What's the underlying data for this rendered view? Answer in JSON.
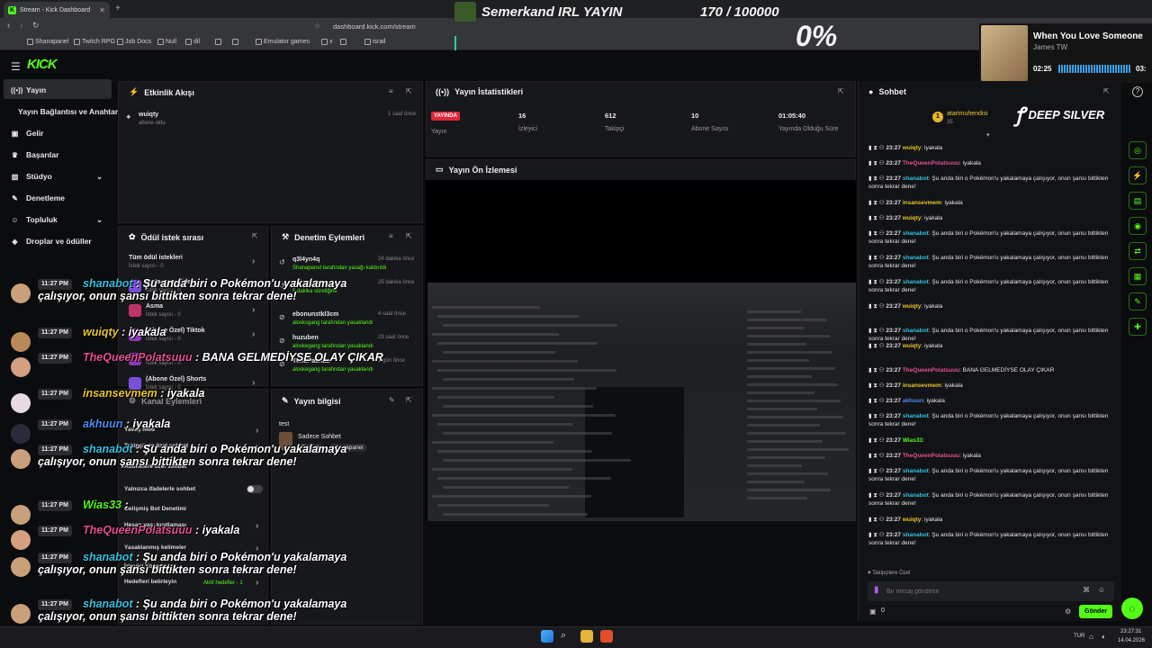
{
  "browser": {
    "tab_title": "Stream - Kick Dashboard",
    "url": "dashboard.kick.com/stream",
    "bookmarks": [
      "Shanapanel",
      "Twitch RPG",
      "Job Docs",
      "Null",
      "dil",
      "",
      "",
      "Emulator games",
      "x",
      "",
      "israil"
    ]
  },
  "overlay": {
    "title": "Semerkand IRL YAYIN",
    "goal": "170 / 100000",
    "percent": "0%",
    "deep_silver": "DEEP SILVER"
  },
  "music": {
    "song": "When You Love Someone",
    "artist": "James TW",
    "elapsed": "02:25",
    "total": "03:"
  },
  "app": {
    "logo": "KICK"
  },
  "sidebar": {
    "items": [
      {
        "label": "Yayın",
        "icon": "live-icon"
      },
      {
        "label": "Yayın Bağlantısı ve Anahtarı",
        "icon": ""
      },
      {
        "label": "Gelir",
        "icon": "dollar-icon"
      },
      {
        "label": "Başarılar",
        "icon": "trophy-icon"
      },
      {
        "label": "Stüdyo",
        "icon": "studio-icon"
      },
      {
        "label": "Denetleme",
        "icon": "wrench-icon"
      },
      {
        "label": "Topluluk",
        "icon": "community-icon"
      },
      {
        "label": "Droplar ve ödüller",
        "icon": "drops-icon"
      }
    ]
  },
  "activity": {
    "title": "Etkinlik Akışı",
    "items": [
      {
        "user": "wuiqty",
        "action": "abone oldu",
        "time": "1 saat önce"
      }
    ]
  },
  "stats": {
    "title": "Yayın İstatistikleri",
    "live_badge": "YAYINDA",
    "live_label": "Yayın",
    "viewers": "16",
    "viewers_label": "İzleyici",
    "followers": "612",
    "followers_label": "Takipçi",
    "subs": "10",
    "subs_label": "Abone Sayısı",
    "uptime": "01:05:40",
    "uptime_label": "Yayında Olduğu Süre"
  },
  "preview": {
    "title": "Yayın Ön İzlemesi"
  },
  "rewards": {
    "title": "Ödül istek sırası",
    "items": [
      {
        "label": "Tüm ödül istekleri",
        "sub": "İstek sayısı - 0"
      },
      {
        "label": "Instagram Video",
        "sub": "İstek sayısı - 0"
      },
      {
        "label": "Asma",
        "sub": "İstek sayısı - 0"
      },
      {
        "label": "(Abone Özel) Tiktok",
        "sub": "İstek sayısı - 0"
      },
      {
        "label": "",
        "sub": "İstek sayısı - 0"
      },
      {
        "label": "(Abone Özel) Shorts",
        "sub": "İstek sayısı - 0"
      }
    ]
  },
  "moderation": {
    "title": "Denetim Eylemleri",
    "items": [
      {
        "user": "q3l4yn4q",
        "detail": "Shanapanel tarafından yasağı kaldırıldı",
        "time": "24 dakika önce"
      },
      {
        "user": "q3l4yn4q",
        "detail": "5 dakika süreliğine",
        "time": "25 dakika önce"
      },
      {
        "user": "ebonunstkl3cm",
        "detail": "alosksgang tarafından yasaklandı",
        "time": "4 saat önce"
      },
      {
        "user": "huzuben",
        "detail": "aloskegang tarafından yasaklandı",
        "time": "23 saat önce"
      },
      {
        "user": "TimuPashaa",
        "detail": "aloskegang tarafından yasaklandı",
        "time": "1 gün önce"
      }
    ]
  },
  "chat_settings": {
    "title": "Kanal Eylemleri",
    "items": [
      "Yavaş mod",
      "Takipçilere özel sohbet",
      "Abonelere özel sohbet",
      "Yalnızca ifadelerle sohbet",
      "Gelişmiş Bot Denetimi",
      "Hesap yaşı kısıtlaması",
      "Yasaklanmış kelimeler",
      "İzleyici Yönetimi",
      "Hedefleri belirleyin"
    ],
    "goal_badge": "Aktif hedefler - 1"
  },
  "stream_info": {
    "title": "Yayın bilgisi",
    "stream_title": "test",
    "category": "Sadece Sohbet",
    "tags": [
      "Turkish",
      "shanapanel"
    ]
  },
  "chat": {
    "title": "Sohbet",
    "pinned_user": "atarimuhendisi",
    "pinned_count": "35",
    "followers_label": "Takipçilere Özel",
    "placeholder": "Bir mesaj gönderin",
    "points": "0",
    "send": "Gönder",
    "messages": [
      {
        "time": "23:27",
        "user": "wuiqty",
        "color": "#e7c52a",
        "text": "iyakala"
      },
      {
        "time": "23:27",
        "user": "TheQueenPolatsuuu",
        "color": "#e74f93",
        "text": "iyakala"
      },
      {
        "time": "23:27",
        "user": "shanabot",
        "color": "#35c0e0",
        "text": "Şu anda biri o Pokémon'u yakalamaya çalışıyor, onun şansı bittikten sonra tekrar dene!"
      },
      {
        "time": "23:27",
        "user": "insansevmem",
        "color": "#e7c52a",
        "text": "iyakala"
      },
      {
        "time": "23:27",
        "user": "wuiqty",
        "color": "#e7c52a",
        "text": "iyakala"
      },
      {
        "time": "23:27",
        "user": "shanabot",
        "color": "#35c0e0",
        "text": "Şu anda biri o Pokémon'u yakalamaya çalışıyor, onun şansı bittikten sonra tekrar dene!"
      },
      {
        "time": "23:27",
        "user": "shanabot",
        "color": "#35c0e0",
        "text": "Şu anda biri o Pokémon'u yakalamaya çalışıyor, onun şansı bittikten sonra tekrar dene!"
      },
      {
        "time": "23:27",
        "user": "shanabot",
        "color": "#35c0e0",
        "text": "Şu anda biri o Pokémon'u yakalamaya çalışıyor, onun şansı bittikten sonra tekrar dene!"
      },
      {
        "time": "23:27",
        "user": "wuiqty",
        "color": "#e7c52a",
        "text": "iyakala"
      },
      {
        "time": "23:27",
        "user": "shanabot",
        "color": "#35c0e0",
        "text": "Şu anda biri o Pokémon'u yakalamaya çalışıyor, onun şansı bittikten sonra tekrar dene!"
      },
      {
        "time": "23:27",
        "user": "wuiqty",
        "color": "#e7c52a",
        "text": "iyakala"
      },
      {
        "time": "23:27",
        "user": "TheQueenPolatsuuu",
        "color": "#e74f93",
        "text": "BANA GELMEDİYSE OLAY ÇIKAR"
      },
      {
        "time": "23:27",
        "user": "insansevmem",
        "color": "#e7c52a",
        "text": "iyakala"
      },
      {
        "time": "23:27",
        "user": "akhuun",
        "color": "#4a8cf0",
        "text": "iyakala"
      },
      {
        "time": "23:27",
        "user": "shanabot",
        "color": "#35c0e0",
        "text": "Şu anda biri o Pokémon'u yakalamaya çalışıyor, onun şansı bittikten sonra tekrar dene!"
      },
      {
        "time": "23:27",
        "user": "Wias33",
        "color": "#53fc18",
        "text": ""
      },
      {
        "time": "23:27",
        "user": "TheQueenPolatsuuu",
        "color": "#e74f93",
        "text": "iyakala"
      },
      {
        "time": "23:27",
        "user": "shanabot",
        "color": "#35c0e0",
        "text": "Şu anda biri o Pokémon'u yakalamaya çalışıyor, onun şansı bittikten sonra tekrar dene!"
      },
      {
        "time": "23:27",
        "user": "shanabot",
        "color": "#35c0e0",
        "text": "Şu anda biri o Pokémon'u yakalamaya çalışıyor, onun şansı bittikten sonra tekrar dene!"
      },
      {
        "time": "23:27",
        "user": "wuiqty",
        "color": "#e7c52a",
        "text": "iyakala"
      },
      {
        "time": "23:27",
        "user": "shanabot",
        "color": "#35c0e0",
        "text": "Şu anda biri o Pokémon'u yakalamaya çalışıyor, onun şansı bittikten sonra tekrar dene!"
      }
    ]
  },
  "overlay_chat": [
    {
      "time": "11:27 PM",
      "user": "shanabot",
      "color": "#35c0e0",
      "text": " : Şu anda biri o Pokémon'u yakalamaya çalışıyor, onun şansı bittikten sonra tekrar dene!"
    },
    {
      "time": "11:27 PM",
      "user": "wuiqty",
      "color": "#e7c52a",
      "text": " : iyakala"
    },
    {
      "time": "11:27 PM",
      "user": "TheQueenPolatsuuu",
      "color": "#e74f93",
      "text": " : BANA GELMEDİYSE OLAY ÇIKAR"
    },
    {
      "time": "11:27 PM",
      "user": "insansevmem",
      "color": "#e7c52a",
      "text": " : iyakala"
    },
    {
      "time": "11:27 PM",
      "user": "akhuun",
      "color": "#4a8cf0",
      "text": " : iyakala"
    },
    {
      "time": "11:27 PM",
      "user": "shanabot",
      "color": "#35c0e0",
      "text": " : Şu anda biri o Pokémon'u yakalamaya çalışıyor, onun şansı bittikten sonra tekrar dene!"
    },
    {
      "time": "11:27 PM",
      "user": "Wias33",
      "color": "#53fc18",
      "text": " :"
    },
    {
      "time": "11:27 PM",
      "user": "TheQueenPolatsuuu",
      "color": "#e74f93",
      "text": " : iyakala"
    },
    {
      "time": "11:27 PM",
      "user": "shanabot",
      "color": "#35c0e0",
      "text": " : Şu anda biri o Pokémon'u yakalamaya çalışıyor, onun şansı bittikten sonra tekrar dene!"
    },
    {
      "time": "11:27 PM",
      "user": "shanabot",
      "color": "#35c0e0",
      "text": " : Şu anda biri o Pokémon'u yakalamaya çalışıyor, onun şansı bittikten sonra tekrar dene!"
    }
  ],
  "taskbar": {
    "lang": "TUR",
    "time": "23:27:31",
    "date": "14.04.2026"
  },
  "colors": {
    "accent": "#53fc18",
    "live": "#e0263a"
  }
}
